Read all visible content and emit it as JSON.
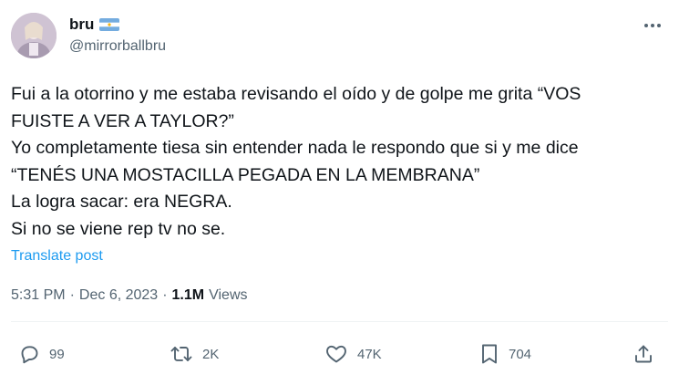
{
  "user": {
    "display_name": "bru",
    "flag_icon": "argentina-flag-icon",
    "handle": "@mirrorballbru"
  },
  "tweet": {
    "lines": [
      "Fui a la otorrino y me estaba revisando el oído y de golpe me grita “VOS",
      "FUISTE A VER A TAYLOR?”",
      "Yo completamente tiesa sin entender nada le respondo que si y me dice",
      "“TENÉS UNA MOSTACILLA PEGADA EN LA MEMBRANA”",
      "La logra sacar: era NEGRA.",
      "Si no se viene rep tv no se."
    ],
    "translate_label": "Translate post"
  },
  "meta": {
    "time": "5:31 PM",
    "separator": "·",
    "date": "Dec 6, 2023",
    "views_count": "1.1M",
    "views_label": "Views"
  },
  "actions": {
    "replies": "99",
    "reposts": "2K",
    "likes": "47K",
    "bookmarks": "704"
  },
  "colors": {
    "text": "#0f1419",
    "secondary": "#536471",
    "link": "#1d9bf0",
    "divider": "#eff3f4"
  }
}
